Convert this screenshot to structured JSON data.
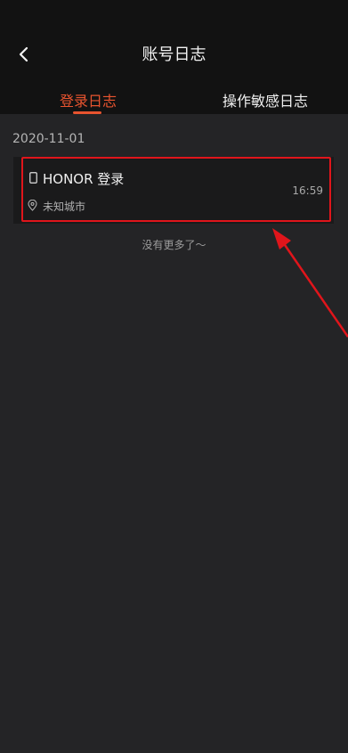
{
  "header": {
    "title": "账号日志",
    "back_icon": "chevron-left-icon"
  },
  "tabs": [
    {
      "label": "登录日志",
      "active": true
    },
    {
      "label": "操作敏感日志",
      "active": false
    }
  ],
  "log_group": {
    "date": "2020-11-01",
    "entries": [
      {
        "device_icon": "phone-icon",
        "title": "HONOR 登录",
        "time": "16:59",
        "location_icon": "location-pin-icon",
        "location": "未知城市"
      }
    ]
  },
  "footer_text": "没有更多了～",
  "colors": {
    "accent": "#e8542f",
    "highlight_annotation": "#e0151b",
    "background": "#242426",
    "bar_background": "#121212"
  }
}
